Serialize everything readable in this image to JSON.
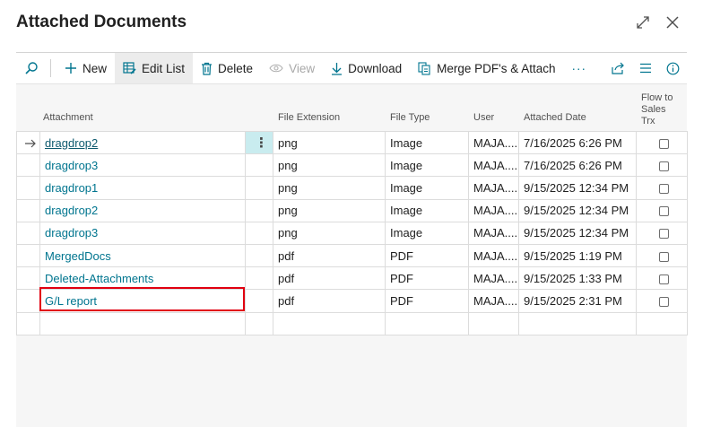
{
  "window": {
    "title": "Attached Documents",
    "expand_icon": "expand-diagonal-icon",
    "close_icon": "close-icon"
  },
  "toolbar": {
    "search_icon": "search-icon",
    "new_label": "New",
    "edit_list_label": "Edit List",
    "delete_label": "Delete",
    "view_label": "View",
    "download_label": "Download",
    "merge_label": "Merge PDF's & Attach",
    "more_label": "···",
    "share_icon": "share-icon",
    "list_icon": "list-view-icon",
    "info_icon": "info-icon"
  },
  "columns": {
    "attachment": "Attachment",
    "file_extension": "File Extension",
    "file_type": "File Type",
    "user": "User",
    "attached_date": "Attached Date",
    "flow_line1": "Flow to",
    "flow_line2": "Sales",
    "flow_line3": "Trx"
  },
  "rows": [
    {
      "name": "dragdrop2",
      "ext": "png",
      "type": "Image",
      "user": "MAJA....",
      "date": "7/16/2025 6:26 PM",
      "flow": false
    },
    {
      "name": "dragdrop3",
      "ext": "png",
      "type": "Image",
      "user": "MAJA....",
      "date": "7/16/2025 6:26 PM",
      "flow": false
    },
    {
      "name": "dragdrop1",
      "ext": "png",
      "type": "Image",
      "user": "MAJA....",
      "date": "9/15/2025 12:34 PM",
      "flow": false
    },
    {
      "name": "dragdrop2",
      "ext": "png",
      "type": "Image",
      "user": "MAJA....",
      "date": "9/15/2025 12:34 PM",
      "flow": false
    },
    {
      "name": "dragdrop3",
      "ext": "png",
      "type": "Image",
      "user": "MAJA....",
      "date": "9/15/2025 12:34 PM",
      "flow": false
    },
    {
      "name": "MergedDocs",
      "ext": "pdf",
      "type": "PDF",
      "user": "MAJA....",
      "date": "9/15/2025 1:19 PM",
      "flow": false
    },
    {
      "name": "Deleted-Attachments",
      "ext": "pdf",
      "type": "PDF",
      "user": "MAJA....",
      "date": "9/15/2025 1:33 PM",
      "flow": false
    },
    {
      "name": "G/L report",
      "ext": "pdf",
      "type": "PDF",
      "user": "MAJA....",
      "date": "9/15/2025 2:31 PM",
      "flow": false
    }
  ],
  "accent_color": "#00758f",
  "highlight_color": "#e10010"
}
